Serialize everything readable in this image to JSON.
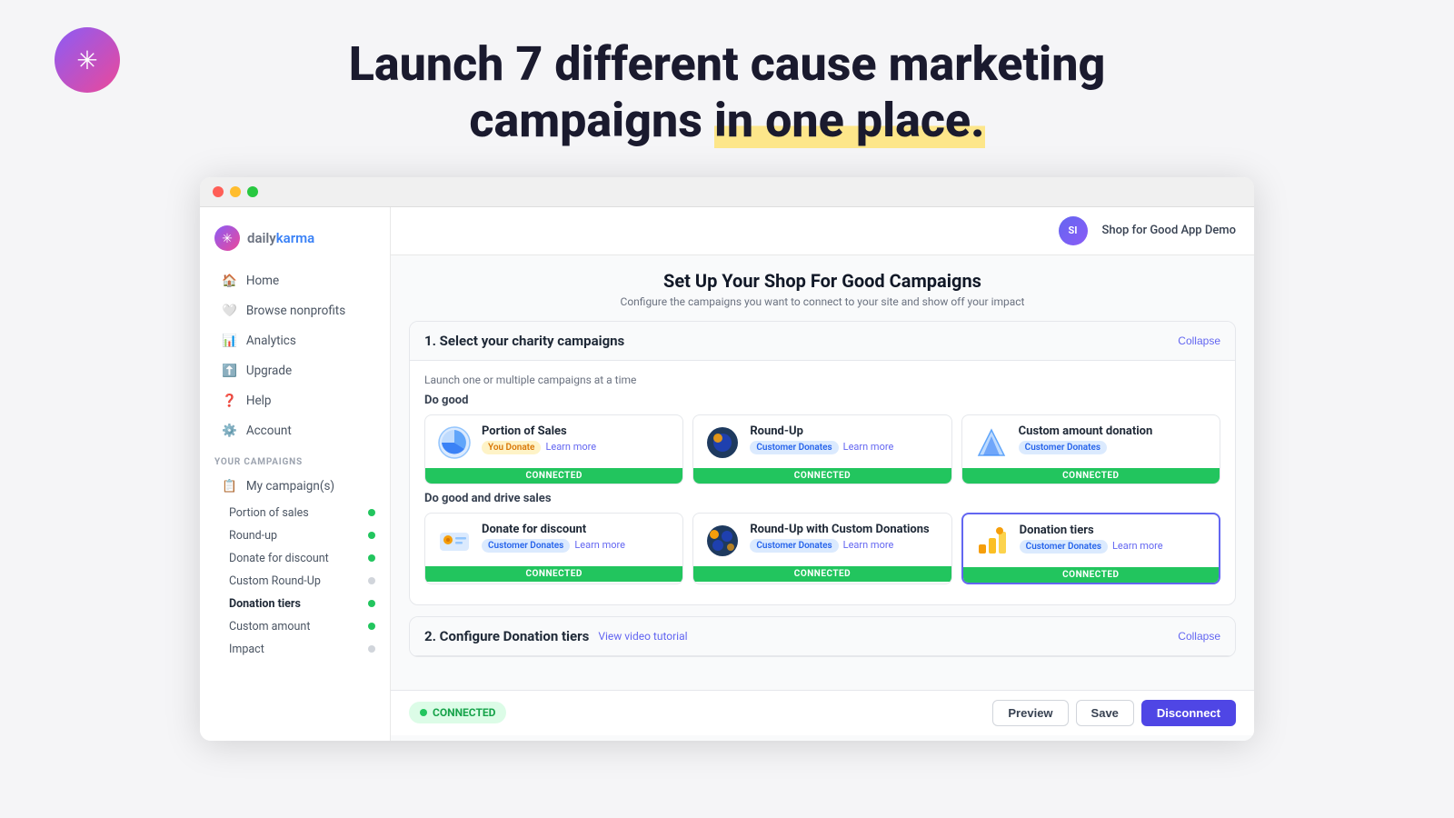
{
  "header": {
    "title_line1": "Launch 7 different cause marketing",
    "title_line2": "campaigns ",
    "title_highlight": "in one place.",
    "logo_text_daily": "daily",
    "logo_text_karma": "karma"
  },
  "sidebar": {
    "brand": {
      "daily": "daily",
      "karma": "karma"
    },
    "nav_items": [
      {
        "id": "home",
        "label": "Home",
        "icon": "🏠"
      },
      {
        "id": "browse",
        "label": "Browse nonprofits",
        "icon": "🤍"
      },
      {
        "id": "analytics",
        "label": "Analytics",
        "icon": "📊"
      },
      {
        "id": "upgrade",
        "label": "Upgrade",
        "icon": "⬆️"
      },
      {
        "id": "help",
        "label": "Help",
        "icon": "❓"
      },
      {
        "id": "account",
        "label": "Account",
        "icon": "⚙️"
      }
    ],
    "campaigns_section_label": "YOUR CAMPAIGNS",
    "my_campaigns_label": "My campaign(s)",
    "campaign_items": [
      {
        "label": "Portion of sales",
        "status": "green"
      },
      {
        "label": "Round-up",
        "status": "green"
      },
      {
        "label": "Donate for discount",
        "status": "green"
      },
      {
        "label": "Custom Round-Up",
        "status": "gray"
      },
      {
        "label": "Donation tiers",
        "status": "green",
        "active": true
      },
      {
        "label": "Custom amount",
        "status": "green"
      },
      {
        "label": "Impact",
        "status": "gray"
      }
    ]
  },
  "topbar": {
    "user_initials": "SI",
    "user_name": "Shop for Good App Demo"
  },
  "main": {
    "setup_title": "Set Up Your Shop For Good Campaigns",
    "setup_subtitle": "Configure the campaigns you want to connect to your site and show off your impact",
    "section1": {
      "title": "1. Select your charity campaigns",
      "collapse_label": "Collapse",
      "launch_hint": "Launch one or multiple campaigns at a time",
      "do_good_label": "Do good",
      "campaigns_row1": [
        {
          "name": "Portion of Sales",
          "icon": "🥧",
          "tags": [
            {
              "label": "You Donate",
              "type": "yellow"
            }
          ],
          "learn_more": "Learn more",
          "connected": true,
          "connected_text": "CONNECTED"
        },
        {
          "name": "Round-Up",
          "icon": "🔵",
          "tags": [
            {
              "label": "Customer Donates",
              "type": "blue"
            }
          ],
          "learn_more": "Learn more",
          "connected": true,
          "connected_text": "CONNECTED"
        },
        {
          "name": "Custom amount donation",
          "icon": "📐",
          "tags": [
            {
              "label": "Customer Donates",
              "type": "blue"
            }
          ],
          "learn_more": null,
          "connected": true,
          "connected_text": "CONNECTED"
        }
      ],
      "do_good_drive_label": "Do good and drive sales",
      "campaigns_row2": [
        {
          "name": "Donate for discount",
          "icon": "🎫",
          "tags": [
            {
              "label": "Customer Donates",
              "type": "blue"
            }
          ],
          "learn_more": "Learn more",
          "connected": true,
          "connected_text": "CONNECTED"
        },
        {
          "name": "Round-Up with Custom Donations",
          "icon": "🌐",
          "tags": [
            {
              "label": "Customer Donates",
              "type": "blue"
            }
          ],
          "learn_more": "Learn more",
          "connected": true,
          "connected_text": "CONNECTED"
        },
        {
          "name": "Donation tiers",
          "icon": "📈",
          "tags": [
            {
              "label": "Customer Donates",
              "type": "blue"
            }
          ],
          "learn_more": "Learn more",
          "connected": true,
          "connected_text": "CONNECTED",
          "selected": true
        }
      ]
    },
    "section2": {
      "title": "2. Configure Donation tiers",
      "video_link": "View video tutorial",
      "collapse_label": "Collapse"
    },
    "bottom_bar": {
      "connected_text": "CONNECTED",
      "preview_label": "Preview",
      "save_label": "Save",
      "disconnect_label": "Disconnect"
    }
  }
}
